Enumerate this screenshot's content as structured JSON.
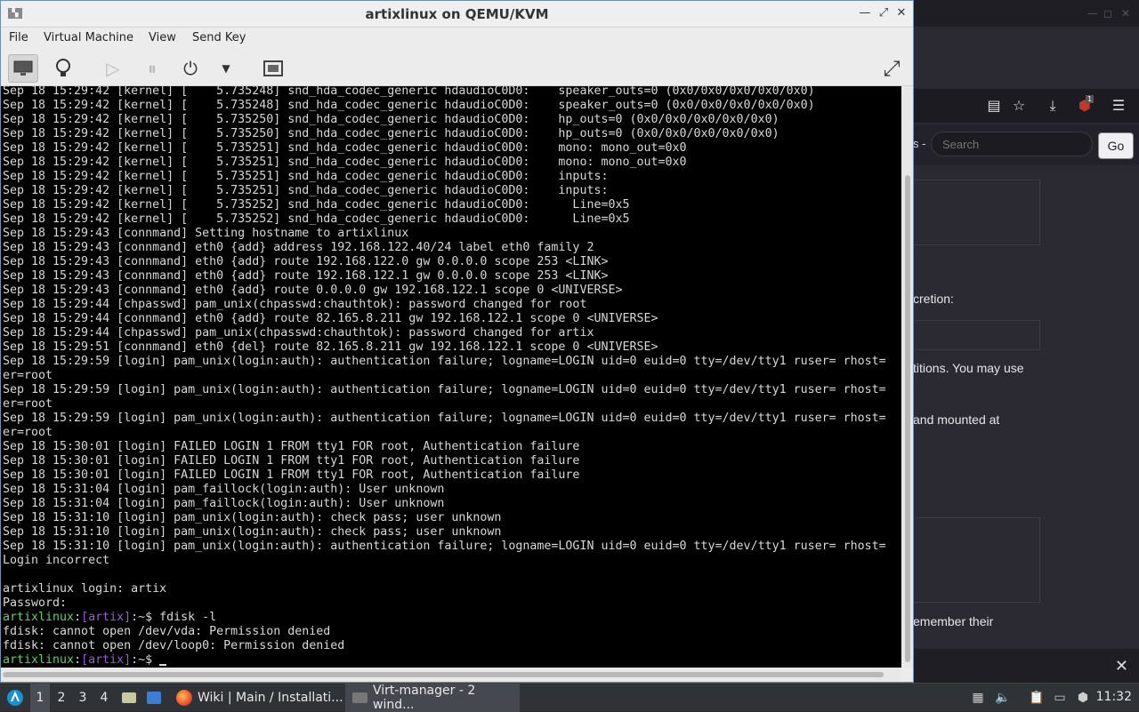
{
  "browser_bg": {
    "search_placeholder": "Search",
    "go_label": "Go",
    "search_prefix": "s -",
    "text_1": "cretion:",
    "text_2": "titions. You may use",
    "text_3": "and mounted at",
    "text_4": "emember their",
    "badge": "1"
  },
  "vm": {
    "title": "artixlinux on QEMU/KVM",
    "menu": [
      "File",
      "Virtual Machine",
      "View",
      "Send Key"
    ]
  },
  "console": {
    "lines": [
      "Sep 18 15:29:42 [kernel] [    5.735248] snd_hda_codec_generic hdaudioC0D0:    speaker_outs=0 (0x0/0x0/0x0/0x0/0x0)",
      "Sep 18 15:29:42 [kernel] [    5.735248] snd_hda_codec_generic hdaudioC0D0:    speaker_outs=0 (0x0/0x0/0x0/0x0/0x0)",
      "Sep 18 15:29:42 [kernel] [    5.735250] snd_hda_codec_generic hdaudioC0D0:    hp_outs=0 (0x0/0x0/0x0/0x0/0x0)",
      "Sep 18 15:29:42 [kernel] [    5.735250] snd_hda_codec_generic hdaudioC0D0:    hp_outs=0 (0x0/0x0/0x0/0x0/0x0)",
      "Sep 18 15:29:42 [kernel] [    5.735251] snd_hda_codec_generic hdaudioC0D0:    mono: mono_out=0x0",
      "Sep 18 15:29:42 [kernel] [    5.735251] snd_hda_codec_generic hdaudioC0D0:    mono: mono_out=0x0",
      "Sep 18 15:29:42 [kernel] [    5.735251] snd_hda_codec_generic hdaudioC0D0:    inputs:",
      "Sep 18 15:29:42 [kernel] [    5.735251] snd_hda_codec_generic hdaudioC0D0:    inputs:",
      "Sep 18 15:29:42 [kernel] [    5.735252] snd_hda_codec_generic hdaudioC0D0:      Line=0x5",
      "Sep 18 15:29:42 [kernel] [    5.735252] snd_hda_codec_generic hdaudioC0D0:      Line=0x5",
      "Sep 18 15:29:43 [connmand] Setting hostname to artixlinux",
      "Sep 18 15:29:43 [connmand] eth0 {add} address 192.168.122.40/24 label eth0 family 2",
      "Sep 18 15:29:43 [connmand] eth0 {add} route 192.168.122.0 gw 0.0.0.0 scope 253 <LINK>",
      "Sep 18 15:29:43 [connmand] eth0 {add} route 192.168.122.1 gw 0.0.0.0 scope 253 <LINK>",
      "Sep 18 15:29:43 [connmand] eth0 {add} route 0.0.0.0 gw 192.168.122.1 scope 0 <UNIVERSE>",
      "Sep 18 15:29:44 [chpasswd] pam_unix(chpasswd:chauthtok): password changed for root",
      "Sep 18 15:29:44 [connmand] eth0 {add} route 82.165.8.211 gw 192.168.122.1 scope 0 <UNIVERSE>",
      "Sep 18 15:29:44 [chpasswd] pam_unix(chpasswd:chauthtok): password changed for artix",
      "Sep 18 15:29:51 [connmand] eth0 {del} route 82.165.8.211 gw 192.168.122.1 scope 0 <UNIVERSE>",
      "Sep 18 15:29:59 [login] pam_unix(login:auth): authentication failure; logname=LOGIN uid=0 euid=0 tty=/dev/tty1 ruser= rhost=",
      "er=root",
      "Sep 18 15:29:59 [login] pam_unix(login:auth): authentication failure; logname=LOGIN uid=0 euid=0 tty=/dev/tty1 ruser= rhost=",
      "er=root",
      "Sep 18 15:29:59 [login] pam_unix(login:auth): authentication failure; logname=LOGIN uid=0 euid=0 tty=/dev/tty1 ruser= rhost=",
      "er=root",
      "Sep 18 15:30:01 [login] FAILED LOGIN 1 FROM tty1 FOR root, Authentication failure",
      "Sep 18 15:30:01 [login] FAILED LOGIN 1 FROM tty1 FOR root, Authentication failure",
      "Sep 18 15:30:01 [login] FAILED LOGIN 1 FROM tty1 FOR root, Authentication failure",
      "Sep 18 15:31:04 [login] pam_faillock(login:auth): User unknown",
      "Sep 18 15:31:04 [login] pam_faillock(login:auth): User unknown",
      "Sep 18 15:31:10 [login] pam_unix(login:auth): check pass; user unknown",
      "Sep 18 15:31:10 [login] pam_unix(login:auth): check pass; user unknown",
      "Sep 18 15:31:10 [login] pam_unix(login:auth): authentication failure; logname=LOGIN uid=0 euid=0 tty=/dev/tty1 ruser= rhost=",
      "Login incorrect",
      "",
      "artixlinux login: artix",
      "Password:"
    ],
    "prompt_host": "artixlinux",
    "prompt_sep": ":",
    "prompt_user": "[artix]",
    "prompt_tail": ":~$ ",
    "command": "fdisk -l",
    "output": [
      "fdisk: cannot open /dev/vda: Permission denied",
      "fdisk: cannot open /dev/loop0: Permission denied"
    ]
  },
  "taskbar": {
    "workspaces": [
      "1",
      "2",
      "3",
      "4"
    ],
    "tasks": [
      {
        "label": "Wiki | Main / Installati..."
      },
      {
        "label": "Virt-manager - 2 wind..."
      }
    ],
    "clock": "11:32"
  }
}
